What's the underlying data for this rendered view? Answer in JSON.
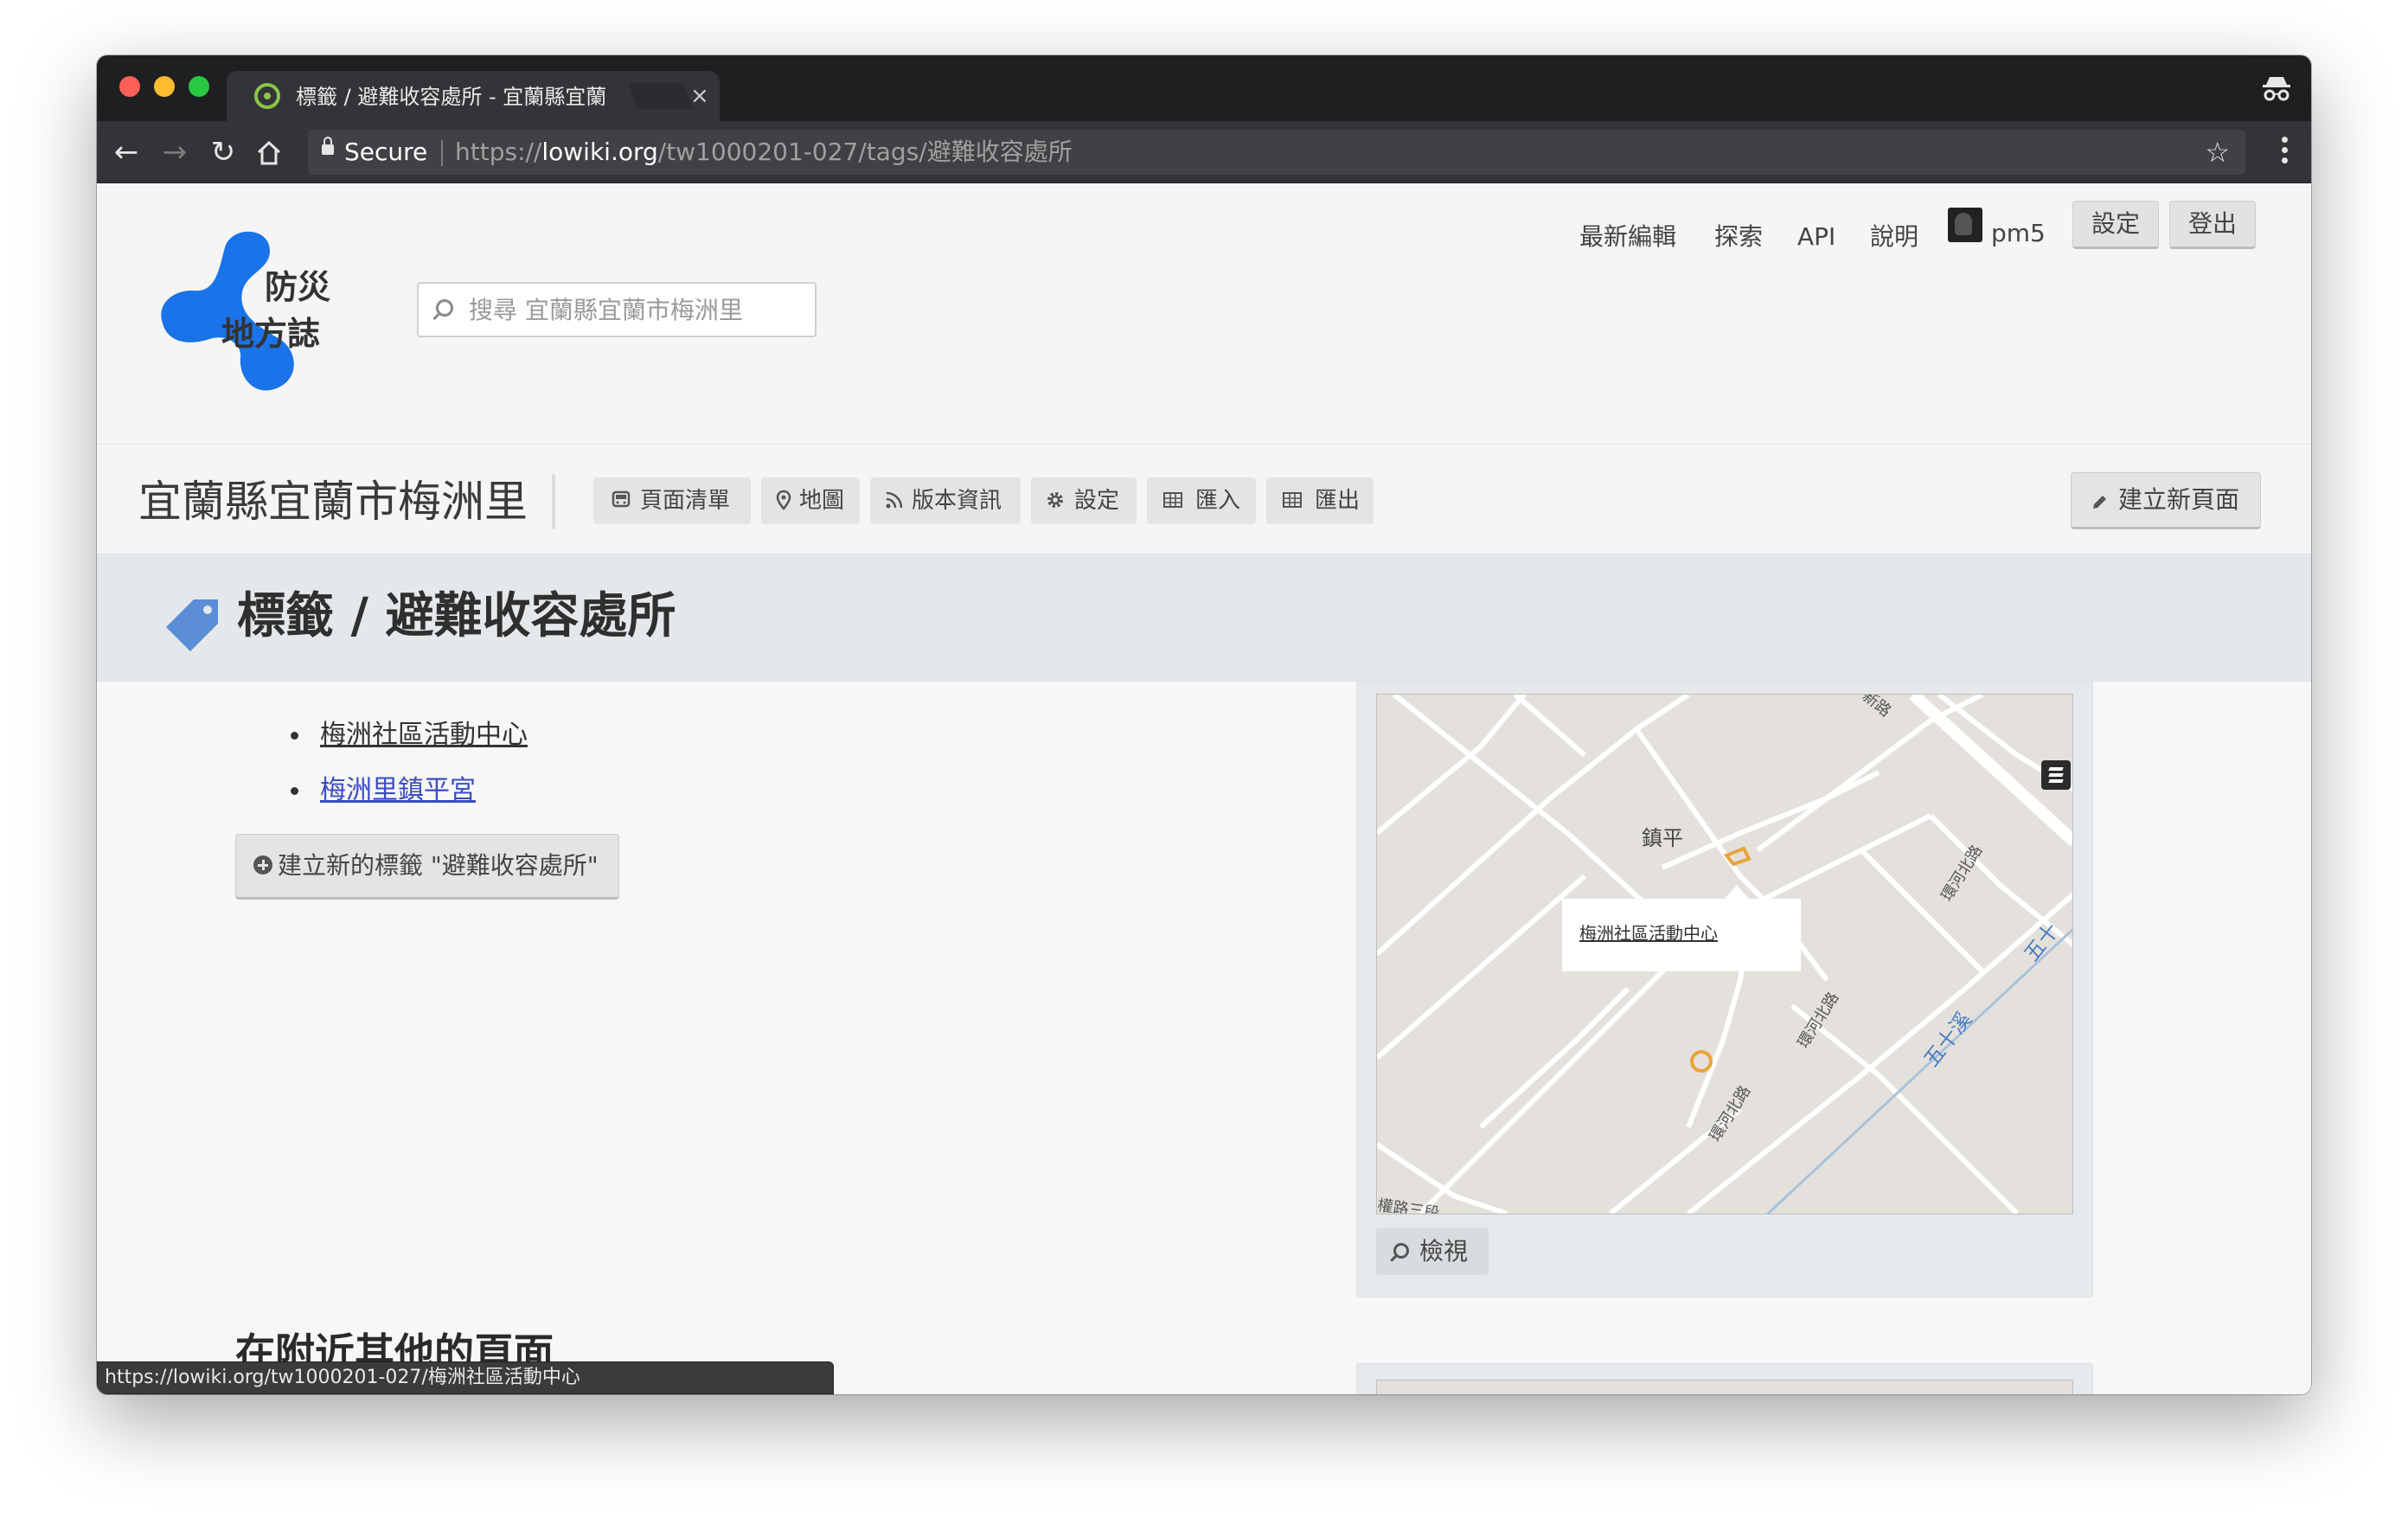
{
  "browser": {
    "tab_title": "標籤 / 避難收容處所 - 宜蘭縣宜蘭",
    "tab_close": "×",
    "secure_label": "Secure",
    "url_scheme": "https://",
    "url_host": "lowiki.org",
    "url_path": "/tw1000201-027/tags/避難收容處所",
    "status_url": "https://lowiki.org/tw1000201-027/梅洲社區活動中心"
  },
  "header": {
    "logo_line1": "防災",
    "logo_line2": "地方誌",
    "search_placeholder": "搜尋 宜蘭縣宜蘭市梅洲里",
    "nav": {
      "recent_edits": "最新編輯",
      "explore": "探索",
      "api": "API",
      "help": "說明",
      "username": "pm5",
      "settings": "設定",
      "logout": "登出"
    }
  },
  "region": {
    "title": "宜蘭縣宜蘭市梅洲里",
    "buttons": {
      "page_list": "頁面清單",
      "map": "地圖",
      "version_info": "版本資訊",
      "settings": "設定",
      "import": "匯入",
      "export": "匯出"
    },
    "create_page": "建立新頁面"
  },
  "tag_page": {
    "title": "標籤 / 避難收容處所",
    "items": [
      "梅洲社區活動中心",
      "梅洲里鎮平宮"
    ],
    "create_tag_button": "建立新的標籤 \"避難收容處所\"",
    "nearby_heading": "在附近其他的頁面"
  },
  "map": {
    "popup_link": "梅洲社區活動中心",
    "labels": {
      "village": "鎮平",
      "road1": "環河北路",
      "road2": "環河北路",
      "road3": "環河北路",
      "river": "五十溪",
      "river2": "五十",
      "road_top": "新路",
      "road_bottom": "權路三段"
    },
    "view_button": "檢視"
  },
  "colors": {
    "accent_blue": "#1a73e8",
    "marker_orange": "#e8a43a",
    "link_visited": "#3a4cc4"
  }
}
